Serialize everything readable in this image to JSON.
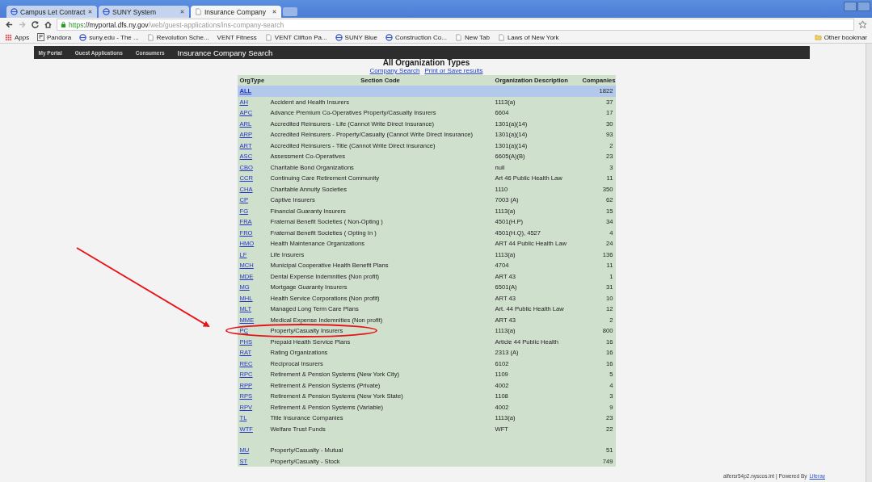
{
  "browser": {
    "tabs": [
      {
        "label": "Campus Let Contract",
        "selected": false,
        "kind": "globe"
      },
      {
        "label": "SUNY System",
        "selected": false,
        "kind": "globe"
      },
      {
        "label": "Insurance Company",
        "selected": true,
        "kind": "page"
      }
    ],
    "address": {
      "scheme": "https",
      "host": "://myportal.dfs.ny.gov",
      "path": "/web/guest-applications/ins-company-search"
    },
    "bookmarks": [
      {
        "label": "Apps",
        "kind": "apps"
      },
      {
        "label": "Pandora",
        "kind": "letter",
        "letter": "P"
      },
      {
        "label": "suny.edu - The ...",
        "kind": "globe"
      },
      {
        "label": "Revolution Sche...",
        "kind": "page"
      },
      {
        "label": "VENT Fitness",
        "kind": "plain"
      },
      {
        "label": "VENT Clifton Pa...",
        "kind": "page"
      },
      {
        "label": "SUNY Blue",
        "kind": "globe"
      },
      {
        "label": "Construction Co...",
        "kind": "globe"
      },
      {
        "label": "New Tab",
        "kind": "page"
      },
      {
        "label": "Laws of New York",
        "kind": "page"
      }
    ],
    "other_bookmarks": "Other bookmar"
  },
  "breadcrumb": [
    {
      "label": "My Portal",
      "current": false
    },
    {
      "label": "Guest Applications",
      "current": false
    },
    {
      "label": "Consumers",
      "current": false
    },
    {
      "label": "Insurance Company Search",
      "current": true
    }
  ],
  "heading": "All Organization Types",
  "links": [
    "Company Search",
    "Print or Save results"
  ],
  "table": {
    "columns": [
      "OrgType",
      "Section Code",
      "Organization Description",
      "Companies"
    ],
    "rows": [
      {
        "code": "ALL",
        "name": "",
        "section": "",
        "count": "1822",
        "selected": true
      },
      {
        "code": "AH",
        "name": "Accident and Health Insurers",
        "section": "1113(a)",
        "count": "37",
        "selected": false
      },
      {
        "code": "APC",
        "name": "Advance Premium Co-Operatives Property/Casualty Insurers",
        "section": "6604",
        "count": "17",
        "selected": false
      },
      {
        "code": "ARL",
        "name": "Accredited Reinsurers - Life (Cannot Write Direct Insurance)",
        "section": "1301(a)(14)",
        "count": "30",
        "selected": false
      },
      {
        "code": "ARP",
        "name": "Accredited Reinsurers - Property/Casualty (Cannot Write Direct Insurance)",
        "section": "1301(a)(14)",
        "count": "93",
        "selected": false
      },
      {
        "code": "ART",
        "name": "Accredited Reinsurers - Title (Cannot Write Direct Insurance)",
        "section": "1301(a)(14)",
        "count": "2",
        "selected": false
      },
      {
        "code": "ASC",
        "name": "Assessment Co-Operatives",
        "section": "6605(A)(B)",
        "count": "23",
        "selected": false
      },
      {
        "code": "CBO",
        "name": "Charitable Bond Organizations",
        "section": "null",
        "count": "3",
        "selected": false
      },
      {
        "code": "CCR",
        "name": "Continuing Care Retirement Community",
        "section": "Art 46 Public Health Law",
        "count": "11",
        "selected": false
      },
      {
        "code": "CHA",
        "name": "Charitable Annuity Societies",
        "section": "1110",
        "count": "350",
        "selected": false
      },
      {
        "code": "CP",
        "name": "Captive Insurers",
        "section": "7003 (A)",
        "count": "62",
        "selected": false
      },
      {
        "code": "FG",
        "name": "Financial Guaranty Insurers",
        "section": "1113(a)",
        "count": "15",
        "selected": false
      },
      {
        "code": "FRA",
        "name": "Fraternal Benefit Societies ( Non-Opting )",
        "section": "4501(H.P)",
        "count": "34",
        "selected": false
      },
      {
        "code": "FRO",
        "name": "Fraternal Benefit Societies ( Opting In )",
        "section": "4501(H.Q), 4527",
        "count": "4",
        "selected": false
      },
      {
        "code": "HMO",
        "name": "Health Maintenance Organizations",
        "section": "ART 44 Public Health Law",
        "count": "24",
        "selected": false
      },
      {
        "code": "LF",
        "name": "Life Insurers",
        "section": "1113(a)",
        "count": "136",
        "selected": false
      },
      {
        "code": "MCH",
        "name": "Municipal Cooperative Health Benefit Plans",
        "section": "4704",
        "count": "11",
        "selected": false
      },
      {
        "code": "MDE",
        "name": "Dental Expense Indemnities (Non profit)",
        "section": "ART 43",
        "count": "1",
        "selected": false
      },
      {
        "code": "MG",
        "name": "Mortgage Guaranty Insurers",
        "section": "6501(A)",
        "count": "31",
        "selected": false
      },
      {
        "code": "MHL",
        "name": "Health Service Corporations (Non profit)",
        "section": "ART 43",
        "count": "10",
        "selected": false
      },
      {
        "code": "MLT",
        "name": "Managed Long Term Care Plans",
        "section": "Art. 44 Public Health Law",
        "count": "12",
        "selected": false
      },
      {
        "code": "MME",
        "name": "Medical Expense Indemnities (Non profit)",
        "section": "ART 43",
        "count": "2",
        "selected": false
      },
      {
        "code": "PC",
        "name": "Property/Casualty Insurers",
        "section": "1113(a)",
        "count": "800",
        "selected": false
      },
      {
        "code": "PHS",
        "name": "Prepaid Health Service Plans",
        "section": "Article 44 Public Health",
        "count": "16",
        "selected": false
      },
      {
        "code": "RAT",
        "name": "Rating Organizations",
        "section": "2313 (A)",
        "count": "16",
        "selected": false
      },
      {
        "code": "REC",
        "name": "Reciprocal Insurers",
        "section": "6102",
        "count": "16",
        "selected": false
      },
      {
        "code": "RPC",
        "name": "Retirement & Pension Systems (New York City)",
        "section": "1109",
        "count": "5",
        "selected": false
      },
      {
        "code": "RPP",
        "name": "Retirement & Pension Systems (Private)",
        "section": "4002",
        "count": "4",
        "selected": false
      },
      {
        "code": "RPS",
        "name": "Retirement & Pension Systems (New York State)",
        "section": "1108",
        "count": "3",
        "selected": false
      },
      {
        "code": "RPV",
        "name": "Retirement & Pension Systems (Variable)",
        "section": "4002",
        "count": "9",
        "selected": false
      },
      {
        "code": "TL",
        "name": "Title Insurance Companies",
        "section": "1113(a)",
        "count": "23",
        "selected": false
      },
      {
        "code": "WTF",
        "name": "Welfare Trust Funds",
        "section": "WFT",
        "count": "22",
        "selected": false
      }
    ],
    "extra_rows": [
      {
        "code": "MU",
        "name": "Property/Casualty - Mutual",
        "section": "",
        "count": "51",
        "selected": false
      },
      {
        "code": "ST",
        "name": "Property/Casualty - Stock",
        "section": "",
        "count": "749",
        "selected": false
      }
    ]
  },
  "footer": {
    "server": "alfersr54p2.nyscos.int | Powered By",
    "link": "Liferay"
  }
}
